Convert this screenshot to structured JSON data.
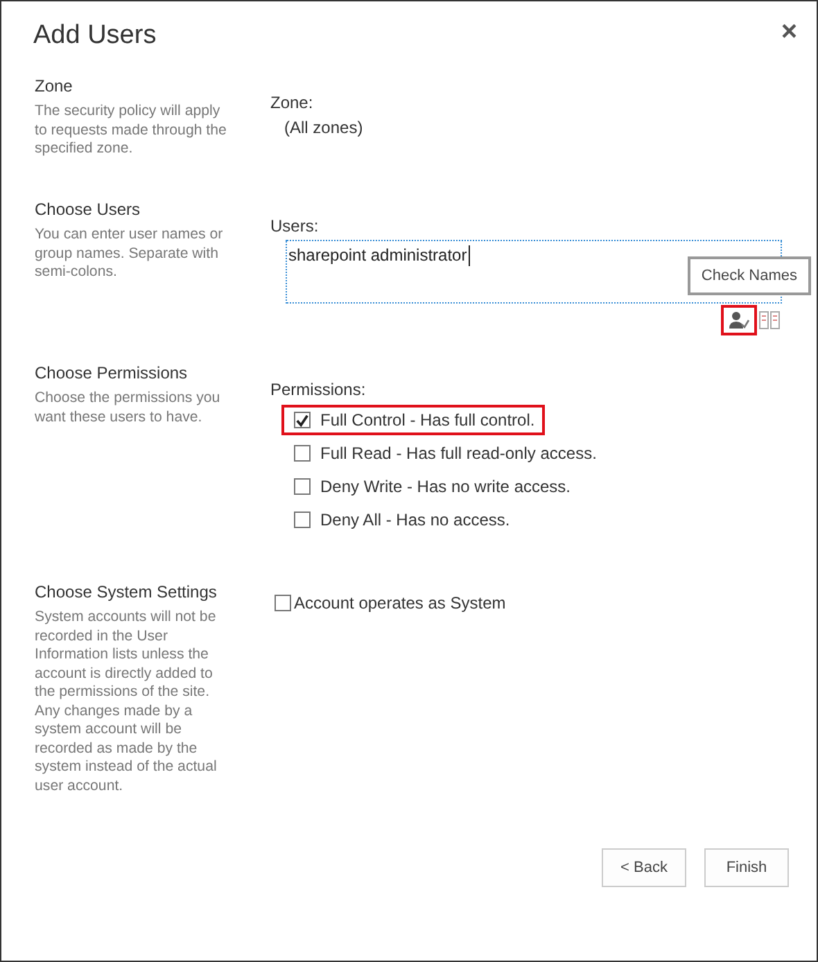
{
  "dialog": {
    "title": "Add Users",
    "close": "×"
  },
  "zone": {
    "heading": "Zone",
    "description": "The security policy will apply to requests made through the specified zone.",
    "label": "Zone:",
    "value": "(All zones)"
  },
  "users": {
    "heading": "Choose Users",
    "description": "You can enter user names or group names. Separate with semi-colons.",
    "label": "Users:",
    "value": "sharepoint administrator",
    "tooltip": "Check Names",
    "check_names_highlighted": true
  },
  "permissions": {
    "heading": "Choose Permissions",
    "description": "Choose the permissions you want these users to have.",
    "label": "Permissions:",
    "options": [
      {
        "label": "Full Control - Has full control.",
        "checked": true,
        "highlighted": true
      },
      {
        "label": "Full Read - Has full read-only access.",
        "checked": false,
        "highlighted": false
      },
      {
        "label": "Deny Write - Has no write access.",
        "checked": false,
        "highlighted": false
      },
      {
        "label": "Deny All - Has no access.",
        "checked": false,
        "highlighted": false
      }
    ]
  },
  "system": {
    "heading": "Choose System Settings",
    "description": "System accounts will not be recorded in the User Information lists unless the account is directly added to the permissions of the site. Any changes made by a system account will be recorded as made by the system instead of the actual user account.",
    "option": {
      "label": "Account operates as System",
      "checked": false
    }
  },
  "buttons": [
    "< Back",
    "Finish"
  ]
}
